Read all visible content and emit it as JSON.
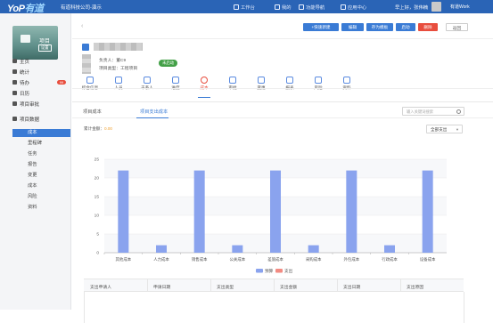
{
  "top": {
    "logo_main": "YoP",
    "logo_sub": "有道",
    "company": "有道科技公司-演示",
    "nav": [
      "工作台",
      "我的",
      "功能导航",
      "应用中心"
    ],
    "user_name": "早上好，张伟楠",
    "switch": "有道Work"
  },
  "sidebar": {
    "project_title": "项目",
    "project_badge": "设置",
    "items": [
      {
        "label": "主页"
      },
      {
        "label": "统计"
      },
      {
        "label": "待办",
        "badge": "99"
      },
      {
        "label": "日历"
      },
      {
        "label": "项目审批"
      },
      {
        "label": "项目数据"
      }
    ],
    "subitems": [
      "成本",
      "里程碑",
      "任务",
      "报告",
      "变更",
      "成本",
      "风险",
      "资料"
    ],
    "active_sub": 0
  },
  "header": {
    "buttons": [
      "+快速新建",
      "编辑",
      "存为模板",
      "启动",
      "删除",
      "返回"
    ],
    "manager_label": "负责人：董C9",
    "type_label": "项目类型：工程项目",
    "status": "未启动"
  },
  "project_tabs": [
    {
      "label": "综合信息",
      "icon": "info-icon"
    },
    {
      "label": "人员",
      "icon": "person-icon"
    },
    {
      "label": "干系人",
      "icon": "group-icon"
    },
    {
      "label": "进度",
      "icon": "progress-icon"
    },
    {
      "label": "成本",
      "icon": "cost-icon",
      "active": true
    },
    {
      "label": "审批",
      "icon": "approve-icon"
    },
    {
      "label": "变更",
      "icon": "change-icon"
    },
    {
      "label": "报表",
      "icon": "report-icon"
    },
    {
      "label": "风险",
      "icon": "risk-icon"
    },
    {
      "label": "资料",
      "icon": "doc-icon"
    }
  ],
  "cost": {
    "subtabs": [
      "项目成本",
      "项目支出成本"
    ],
    "search_placeholder": "输入关键词搜索",
    "total_label": "累计金额：",
    "total_value": "0.00",
    "filter": "全部支出"
  },
  "chart_data": {
    "type": "bar",
    "categories": [
      "其他成本",
      "人力成本",
      "销售成本",
      "公关成本",
      "差旅成本",
      "采购成本",
      "外包成本",
      "行政成本",
      "设备成本"
    ],
    "series": [
      {
        "name": "预算",
        "values": [
          22,
          2,
          22,
          2,
          22,
          2,
          22,
          2,
          22
        ],
        "color": "#8aa3ee"
      },
      {
        "name": "支出",
        "values": [
          0,
          0,
          0,
          0,
          0,
          0,
          0,
          0,
          0
        ],
        "color": "#f28b82"
      }
    ],
    "yticks": [
      0,
      5,
      10,
      15,
      20,
      25
    ],
    "ylim": [
      0,
      25
    ],
    "grid": true,
    "legend": "bottom"
  },
  "table": {
    "headers": [
      "支出申请人",
      "申请日期",
      "支出类型",
      "支出金额",
      "支出日期",
      "支出原因"
    ]
  }
}
